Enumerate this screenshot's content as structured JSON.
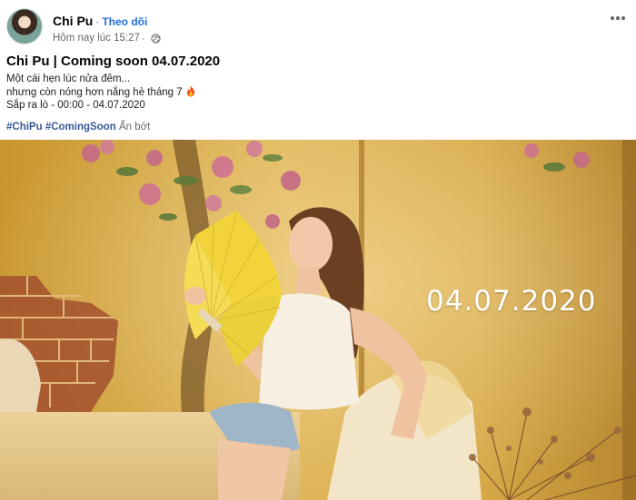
{
  "post": {
    "author": "Chi Pu",
    "separator": "·",
    "follow_label": "Theo dõi",
    "timestamp": "Hôm nay lúc 15:27",
    "separator2": "·",
    "privacy_icon": "globe-icon",
    "more_icon": "more-options-icon",
    "title": "Chi Pu | Coming soon 04.07.2020",
    "body_lines": [
      "Một cái hẹn lúc nửa đêm...",
      "nhưng còn nóng hơn nắng hè tháng 7",
      "Sắp ra lò - 00:00 - 04.07.2020"
    ],
    "emoji_icon": "fire-icon",
    "hashtags": [
      "#ChiPu",
      "#ComingSoon"
    ],
    "see_less": "Ẩn bớt"
  },
  "photo": {
    "overlay_text": "04.07.2020",
    "description_icon": "post-photo"
  },
  "colors": {
    "link_blue": "#216fdb",
    "hashtag_blue": "#385898",
    "meta_gray": "#65676b",
    "fan_yellow": "#f2d43a"
  }
}
